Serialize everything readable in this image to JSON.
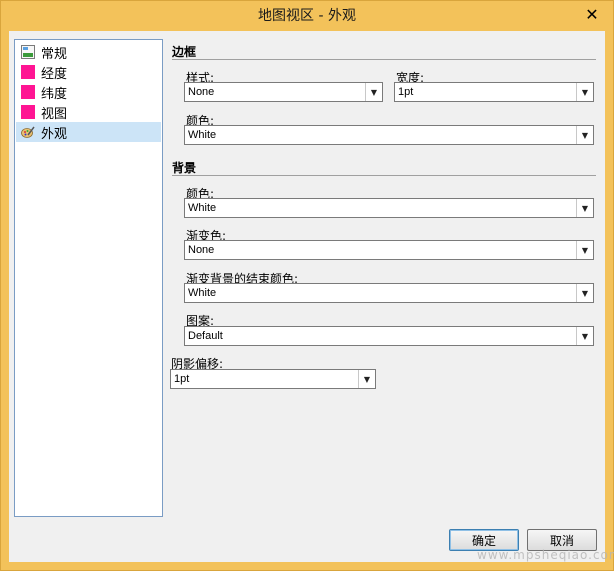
{
  "window": {
    "title": "地图视区 - 外观",
    "close_glyph": "✕"
  },
  "sidebar": {
    "items": [
      {
        "label": "常规",
        "icon": "map-general-icon"
      },
      {
        "label": "经度",
        "icon": "pink-square-icon",
        "color": "#ff1493"
      },
      {
        "label": "纬度",
        "icon": "pink-square-icon",
        "color": "#ff1493"
      },
      {
        "label": "视图",
        "icon": "pink-square-icon",
        "color": "#ff1493"
      },
      {
        "label": "外观",
        "icon": "paint-brush-icon",
        "selected": true
      }
    ]
  },
  "border": {
    "title": "边框",
    "style_label": "样式:",
    "style_value": "None",
    "width_label": "宽度:",
    "width_value": "1pt",
    "color_label": "颜色:",
    "color_value": "White"
  },
  "background": {
    "title": "背景",
    "color_label": "颜色:",
    "color_value": "White",
    "gradient_label": "渐变色:",
    "gradient_value": "None",
    "gradient_end_label": "渐变背景的结束颜色:",
    "gradient_end_value": "White",
    "pattern_label": "图案:",
    "pattern_value": "Default"
  },
  "shadow": {
    "label": "阴影偏移:",
    "value": "1pt"
  },
  "buttons": {
    "ok": "确定",
    "cancel": "取消"
  },
  "watermark": "www.mpsheqiao.com"
}
